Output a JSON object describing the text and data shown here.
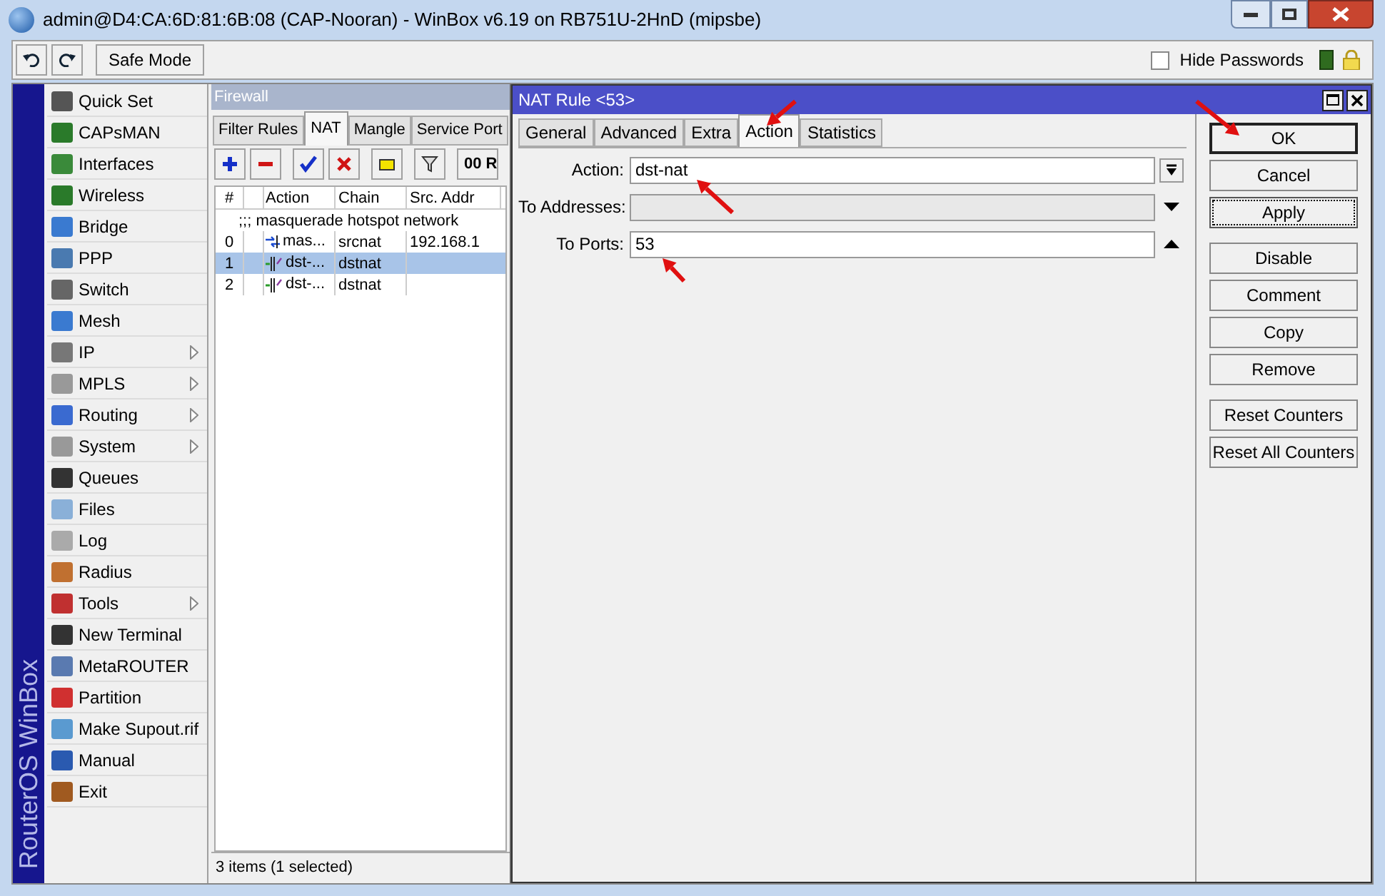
{
  "window": {
    "title": "admin@D4:CA:6D:81:6B:08 (CAP-Nooran) - WinBox v6.19 on RB751U-2HnD (mipsbe)"
  },
  "toolbar": {
    "safe_mode": "Safe Mode",
    "hide_passwords": {
      "label": "Hide Passwords",
      "checked": false
    }
  },
  "brand": "RouterOS WinBox",
  "sidebar": {
    "items": [
      {
        "label": "Quick Set",
        "submenu": false
      },
      {
        "label": "CAPsMAN",
        "submenu": false
      },
      {
        "label": "Interfaces",
        "submenu": false
      },
      {
        "label": "Wireless",
        "submenu": false
      },
      {
        "label": "Bridge",
        "submenu": false
      },
      {
        "label": "PPP",
        "submenu": false
      },
      {
        "label": "Switch",
        "submenu": false
      },
      {
        "label": "Mesh",
        "submenu": false
      },
      {
        "label": "IP",
        "submenu": true
      },
      {
        "label": "MPLS",
        "submenu": true
      },
      {
        "label": "Routing",
        "submenu": true
      },
      {
        "label": "System",
        "submenu": true
      },
      {
        "label": "Queues",
        "submenu": false
      },
      {
        "label": "Files",
        "submenu": false
      },
      {
        "label": "Log",
        "submenu": false
      },
      {
        "label": "Radius",
        "submenu": false
      },
      {
        "label": "Tools",
        "submenu": true
      },
      {
        "label": "New Terminal",
        "submenu": false
      },
      {
        "label": "MetaROUTER",
        "submenu": false
      },
      {
        "label": "Partition",
        "submenu": false
      },
      {
        "label": "Make Supout.rif",
        "submenu": false
      },
      {
        "label": "Manual",
        "submenu": false
      },
      {
        "label": "Exit",
        "submenu": false
      }
    ]
  },
  "firewall": {
    "title": "Firewall",
    "tabs": [
      {
        "label": "Filter Rules",
        "selected": false
      },
      {
        "label": "NAT",
        "selected": true
      },
      {
        "label": "Mangle",
        "selected": false
      },
      {
        "label": "Service Port",
        "selected": false
      }
    ],
    "reset_button": "00 R",
    "table": {
      "columns": [
        "#",
        "Action",
        "Chain",
        "Src. Addr"
      ],
      "comment": ";;; masquerade hotspot network",
      "rows": [
        {
          "number": "0",
          "action": "mas...",
          "kind": "masquerade",
          "chain": "srcnat",
          "src": "192.168.1",
          "selected": false
        },
        {
          "number": "1",
          "action": "dst-...",
          "kind": "dstnat",
          "chain": "dstnat",
          "selected": true
        },
        {
          "number": "2",
          "action": "dst-...",
          "kind": "dstnat",
          "chain": "dstnat",
          "selected": false
        }
      ]
    },
    "status": "3 items (1 selected)"
  },
  "dialog": {
    "title": "NAT Rule <53>",
    "tabs": [
      {
        "label": "General",
        "selected": false
      },
      {
        "label": "Advanced",
        "selected": false
      },
      {
        "label": "Extra",
        "selected": false
      },
      {
        "label": "Action",
        "selected": true
      },
      {
        "label": "Statistics",
        "selected": false
      }
    ],
    "fields": [
      {
        "label": "Action:",
        "value": "dst-nat",
        "kind": "select",
        "disabled": false
      },
      {
        "label": "To Addresses:",
        "kind": "down",
        "disabled": true
      },
      {
        "label": "To Ports:",
        "value": "53",
        "kind": "up",
        "disabled": false
      }
    ],
    "button_groups": [
      [
        {
          "label": "OK",
          "kind": "default"
        },
        {
          "label": "Cancel",
          "kind": "normal"
        },
        {
          "label": "Apply",
          "kind": "focused"
        }
      ],
      [
        {
          "label": "Disable",
          "kind": "normal"
        },
        {
          "label": "Comment",
          "kind": "normal"
        },
        {
          "label": "Copy",
          "kind": "normal"
        },
        {
          "label": "Remove",
          "kind": "normal"
        }
      ],
      [
        {
          "label": "Reset Counters",
          "kind": "normal"
        },
        {
          "label": "Reset All Counters",
          "kind": "normal"
        }
      ]
    ]
  }
}
